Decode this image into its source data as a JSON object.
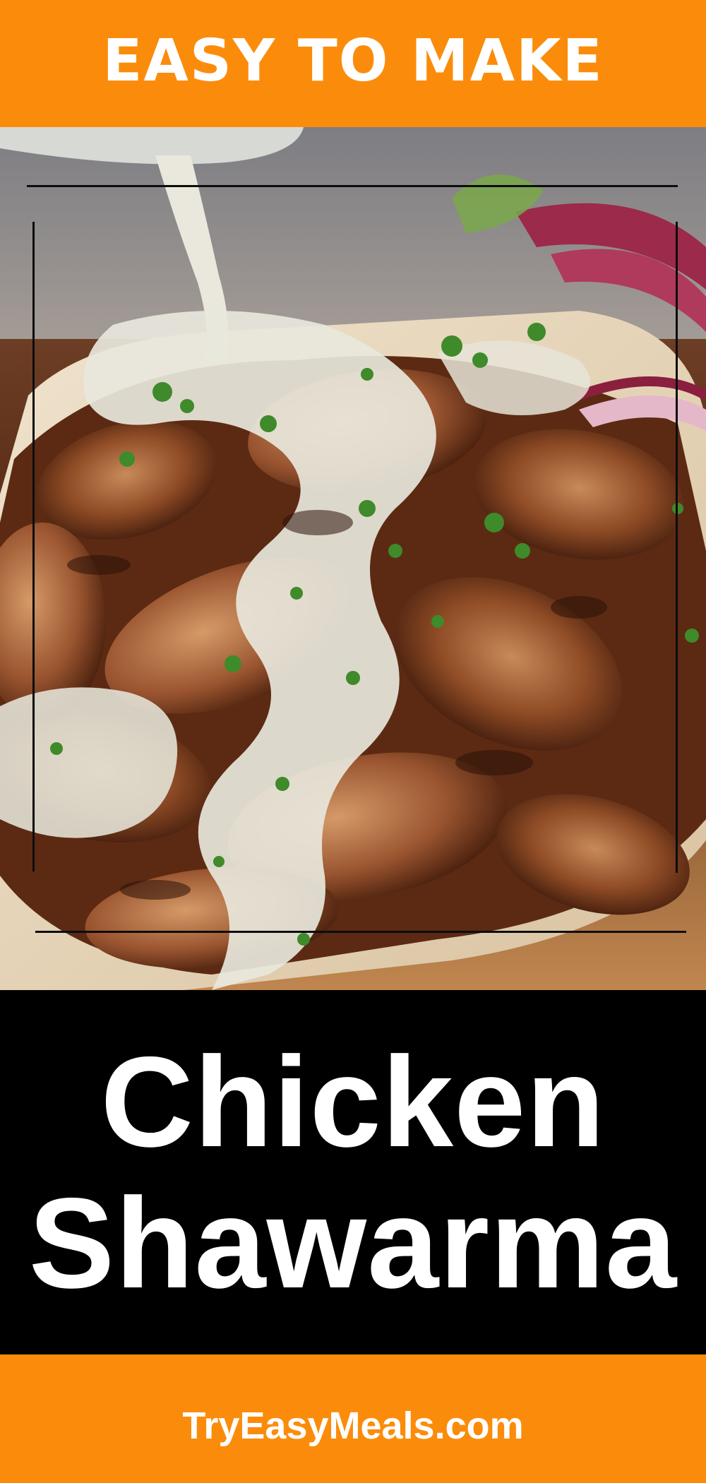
{
  "header": {
    "tagline": "EASY TO MAKE"
  },
  "hero": {
    "image_subject": "chicken-shawarma-photo"
  },
  "title": {
    "line1": "Chicken",
    "line2": "Shawarma"
  },
  "footer": {
    "site": "TryEasyMeals.com"
  },
  "colors": {
    "banner": "#fb8c0b",
    "title_background": "#000000",
    "text": "#ffffff"
  }
}
